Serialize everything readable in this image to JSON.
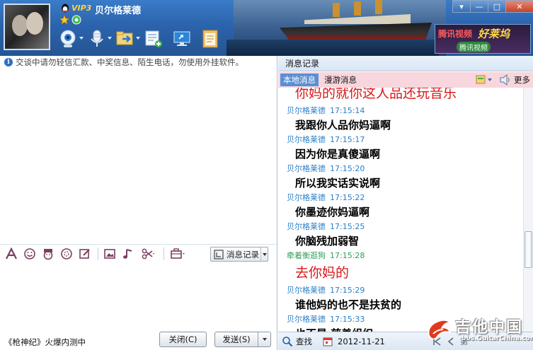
{
  "header": {
    "vip_label": "VIP3",
    "nickname": "贝尔格莱德",
    "ad": {
      "line1": "腾讯视频",
      "line2": "好莱坞",
      "line3": "腾讯视频"
    }
  },
  "toolbar": {
    "icons": [
      "camera-icon",
      "microphone-icon",
      "file-transfer-icon",
      "app-icon",
      "remote-desktop-icon",
      "notepad-icon"
    ]
  },
  "window_controls": [
    "menu-icon",
    "minimize-icon",
    "maximize-icon",
    "close-icon"
  ],
  "left": {
    "notice": "交谈中请勿轻信汇款、中奖信息、陌生电话，勿使用外挂软件。",
    "record_button": "消息记录",
    "ad_text": "《枪神纪》火爆内测中",
    "close_button": "关闭(C)",
    "send_button": "发送(S)"
  },
  "right": {
    "title": "消息记录",
    "tabs": {
      "local": "本地消息",
      "roaming": "漫游消息"
    },
    "more": "更多",
    "entries": [
      {
        "kind": "content-red",
        "text": "你妈的就你这人品还玩音乐"
      },
      {
        "kind": "meta",
        "sender": "贝尔格莱德",
        "time": "17:15:14"
      },
      {
        "kind": "content",
        "text": "我跟你人品你妈逼啊"
      },
      {
        "kind": "meta",
        "sender": "贝尔格莱德",
        "time": "17:15:17"
      },
      {
        "kind": "content",
        "text": "因为你是真傻逼啊"
      },
      {
        "kind": "meta",
        "sender": "贝尔格莱德",
        "time": "17:15:20"
      },
      {
        "kind": "content",
        "text": "所以我实话实说啊"
      },
      {
        "kind": "meta",
        "sender": "贝尔格莱德",
        "time": "17:15:22"
      },
      {
        "kind": "content",
        "text": "你墨迹你妈逼啊"
      },
      {
        "kind": "meta",
        "sender": "贝尔格莱德",
        "time": "17:15:25"
      },
      {
        "kind": "content",
        "text": "你脑残加弱智"
      },
      {
        "kind": "meta-green",
        "sender": "牵着衡逛狗",
        "time": "17:15:28"
      },
      {
        "kind": "content-red",
        "text": "去你妈的"
      },
      {
        "kind": "meta",
        "sender": "贝尔格莱德",
        "time": "17:15:29"
      },
      {
        "kind": "content",
        "text": "谁他妈的也不是扶贫的"
      },
      {
        "kind": "meta",
        "sender": "贝尔格莱德",
        "time": "17:15:33"
      },
      {
        "kind": "content",
        "text": "也不是 慈善组织"
      }
    ],
    "search_label": "查找",
    "date": "2012-11-21",
    "page_label": "第"
  },
  "watermark": {
    "big": "吉他中国",
    "small": "bbs.GuitarChina.com"
  },
  "colors": {
    "header_blue": "#2c63ad",
    "tab_pink": "#f7d6dd",
    "meta_blue": "#2a7fc9",
    "meta_green": "#2f9c5a",
    "red_text": "#d81818"
  }
}
